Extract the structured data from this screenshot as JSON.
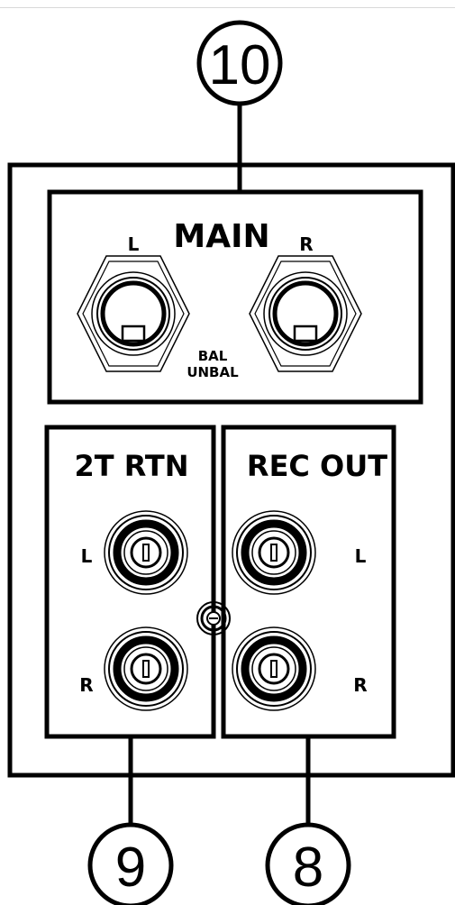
{
  "callouts": {
    "top": "10",
    "bottom_left": "9",
    "bottom_right": "8"
  },
  "main": {
    "title": "MAIN",
    "left": "L",
    "right": "R",
    "bal": "BAL",
    "unbal": "UNBAL"
  },
  "rtn": {
    "title": "2T RTN",
    "left": "L",
    "right": "R"
  },
  "rec": {
    "title": "REC OUT",
    "left": "L",
    "right": "R"
  },
  "colors": {
    "ink": "#000000",
    "paper": "#ffffff",
    "rule": "#d8d8d8"
  }
}
